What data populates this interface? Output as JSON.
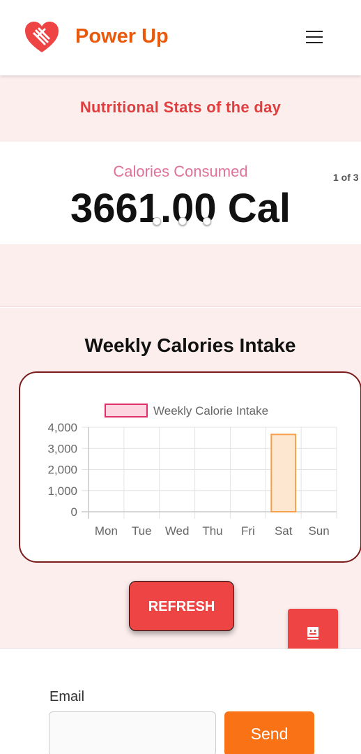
{
  "header": {
    "brand": "Power Up",
    "logo_icon": "heart-dumbbell-icon",
    "menu_icon": "hamburger-menu-icon",
    "accent": "#e8590c"
  },
  "stats": {
    "title": "Nutritional Stats of the day",
    "carousel": {
      "label": "Calories Consumed",
      "value": "3661.00 Cal",
      "counter": "1 of 3",
      "slides": 3,
      "active_slide": 1
    }
  },
  "weekly": {
    "title": "Weekly Calories Intake",
    "refresh_label": "REFRESH",
    "chat_icon": "chat-bot-icon"
  },
  "chart_data": {
    "type": "bar",
    "categories": [
      "Mon",
      "Tue",
      "Wed",
      "Thu",
      "Fri",
      "Sat",
      "Sun"
    ],
    "series": [
      {
        "name": "Weekly Calorie Intake",
        "values": [
          0,
          0,
          0,
          0,
          0,
          3661,
          0
        ]
      }
    ],
    "yticks": [
      "4,000",
      "3,000",
      "2,000",
      "1,000",
      "0"
    ],
    "ylim": [
      0,
      4000
    ],
    "legend": "top",
    "grid": true,
    "bar_fill": "#fde7d0",
    "bar_stroke": "#f5a04c",
    "legend_fill": "#fdd5e0",
    "legend_stroke": "#e0306a"
  },
  "email": {
    "label": "Email",
    "value": "",
    "placeholder": "",
    "send_label": "Send"
  }
}
